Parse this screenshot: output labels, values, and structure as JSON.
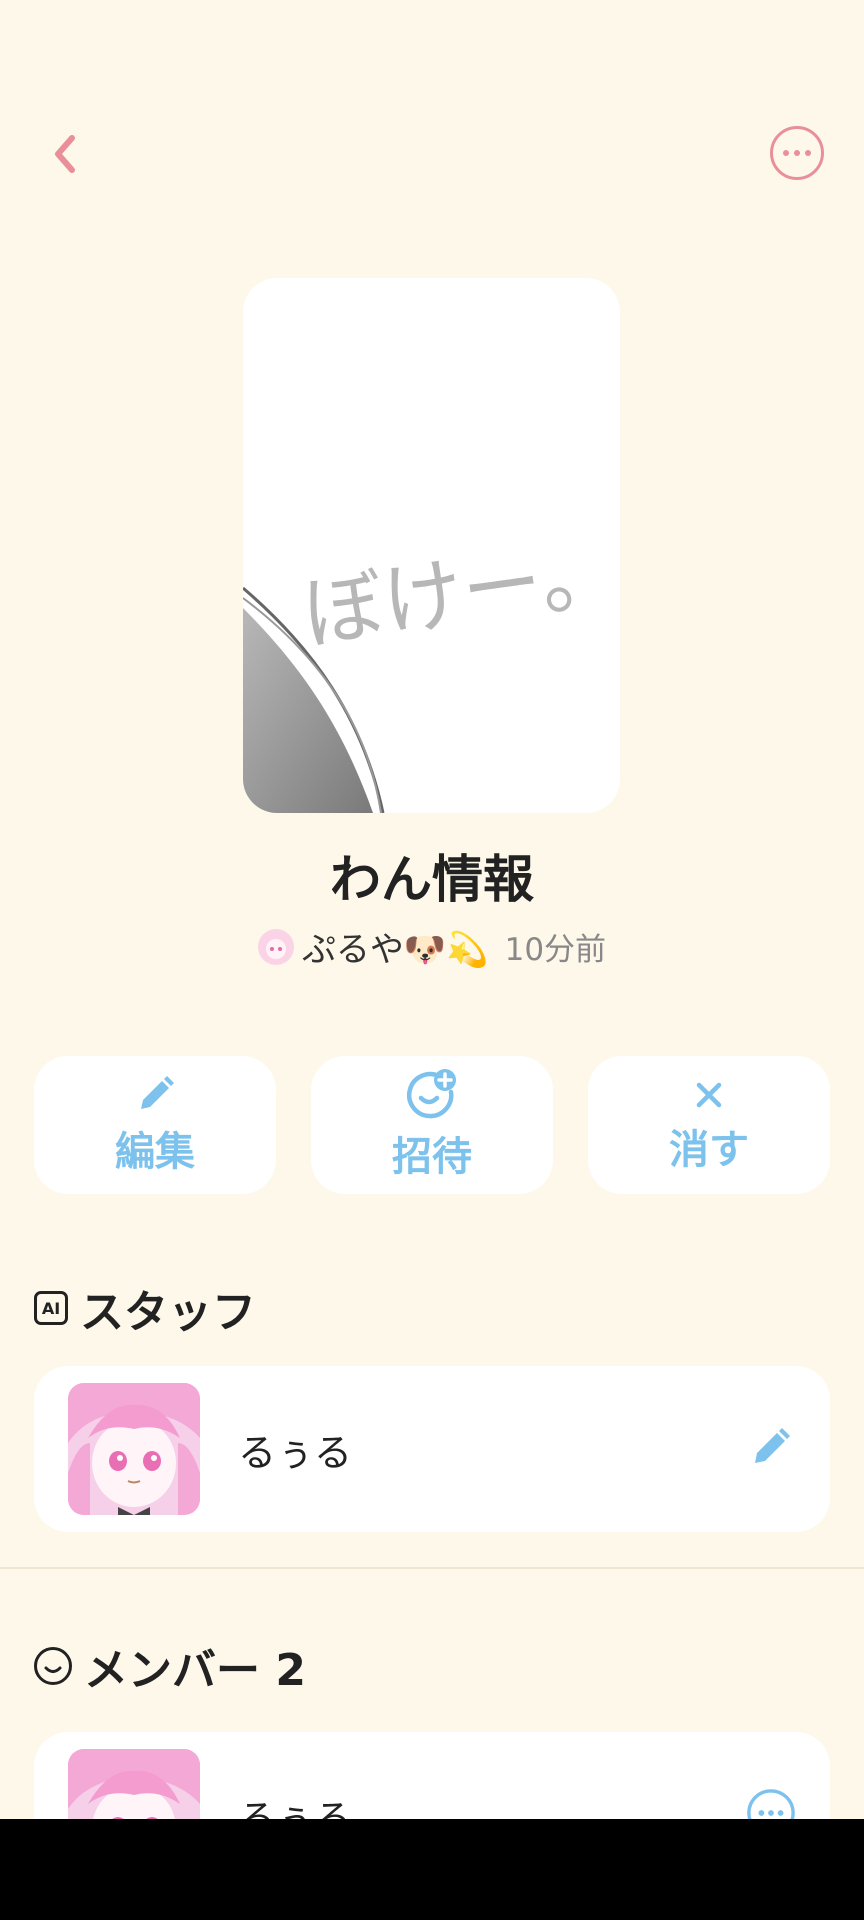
{
  "header": {
    "back_icon": "chevron-left-icon",
    "more_icon": "more-horizontal-circle-icon",
    "accent_color": "#e98f9a"
  },
  "cover": {
    "handwritten_text": "ぼけー。"
  },
  "room": {
    "title": "わん情報",
    "author": "ぷるや🐶💫",
    "time": "10分前"
  },
  "actions": [
    {
      "label": "編集",
      "icon": "pencil-icon"
    },
    {
      "label": "招待",
      "icon": "add-person-icon"
    },
    {
      "label": "消す",
      "icon": "close-icon"
    }
  ],
  "action_color": "#7cc2ec",
  "staff_section": {
    "title": "スタッフ",
    "icon": "ai-badge-icon",
    "members": [
      {
        "name": "るぅる",
        "trailing_icon": "pencil-icon"
      }
    ]
  },
  "member_section": {
    "title": "メンバー 2",
    "icon": "smile-icon",
    "members": [
      {
        "name": "るぅる",
        "trailing_icon": "more-horizontal-circle-icon"
      }
    ]
  }
}
